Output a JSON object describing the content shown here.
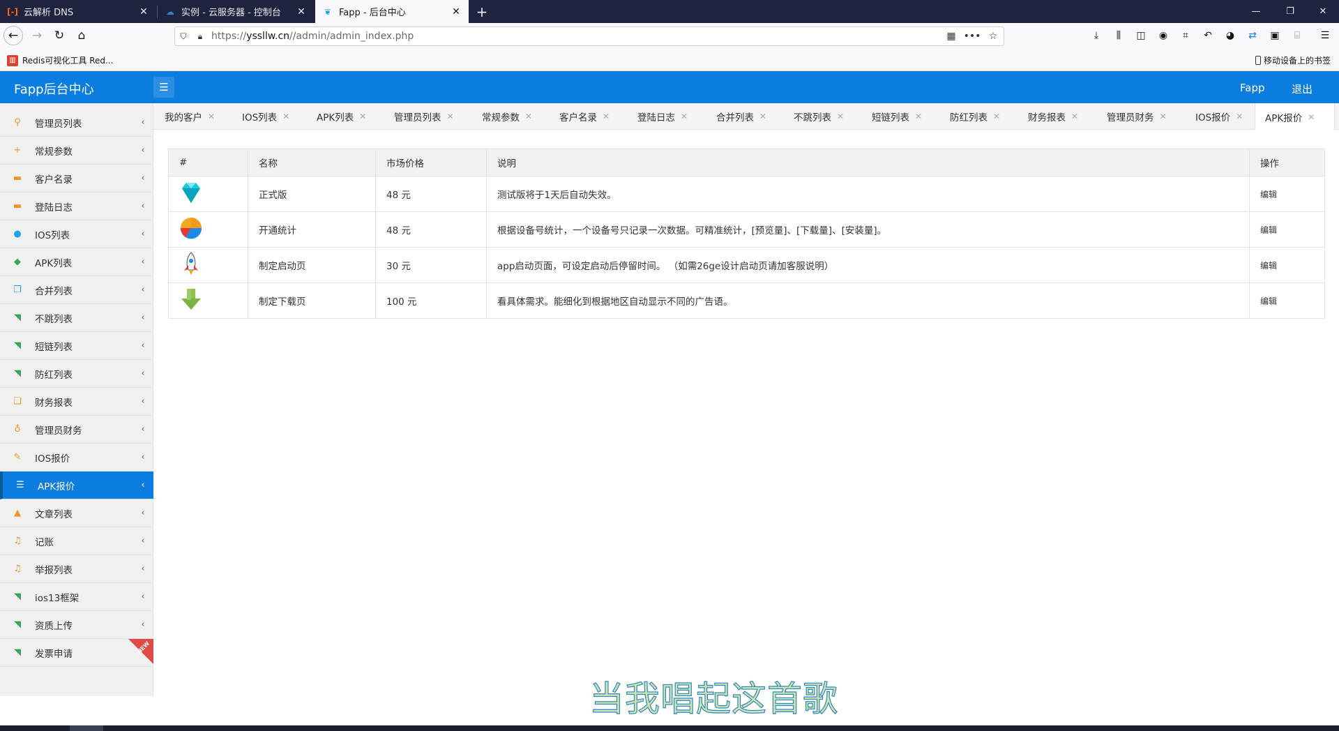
{
  "browser": {
    "tabs": [
      {
        "title": "云解析 DNS"
      },
      {
        "title": "实例 - 云服务器 - 控制台"
      },
      {
        "title": "Fapp - 后台中心"
      }
    ],
    "url_prefix": "https://",
    "url_domain": "yssllw.cn",
    "url_path": "//admin/admin_index.php",
    "bookmark": "Redis可视化工具 Red...",
    "bookmark_right": "移动设备上的书签"
  },
  "header": {
    "brand": "Fapp后台中心",
    "links": [
      "Fapp",
      "退出"
    ]
  },
  "sidebar": {
    "items": [
      {
        "label": "管理员列表",
        "icon": "key-icon",
        "glyph": "⚲",
        "color": "#f0932b"
      },
      {
        "label": "常规参数",
        "icon": "plus-icon",
        "glyph": "+",
        "color": "#f0932b"
      },
      {
        "label": "客户名录",
        "icon": "briefcase-icon",
        "glyph": "▬",
        "color": "#f0932b"
      },
      {
        "label": "登陆日志",
        "icon": "briefcase-icon",
        "glyph": "▬",
        "color": "#f0932b"
      },
      {
        "label": "IOS列表",
        "icon": "apple-icon",
        "glyph": "●",
        "color": "#20a4e8"
      },
      {
        "label": "APK列表",
        "icon": "android-icon",
        "glyph": "◆",
        "color": "#3aa655"
      },
      {
        "label": "合并列表",
        "icon": "copy-icon",
        "glyph": "❐",
        "color": "#20a4e8"
      },
      {
        "label": "不跳列表",
        "icon": "rss-icon",
        "glyph": "◥",
        "color": "#3aa655"
      },
      {
        "label": "短链列表",
        "icon": "rss-icon",
        "glyph": "◥",
        "color": "#3aa655"
      },
      {
        "label": "防红列表",
        "icon": "rss-icon",
        "glyph": "◥",
        "color": "#3aa655"
      },
      {
        "label": "财务报表",
        "icon": "files-icon",
        "glyph": "❏",
        "color": "#f0932b"
      },
      {
        "label": "管理员财务",
        "icon": "stethoscope-icon",
        "glyph": "♁",
        "color": "#f0932b"
      },
      {
        "label": "IOS报价",
        "icon": "pencil-icon",
        "glyph": "✎",
        "color": "#f0932b"
      },
      {
        "label": "APK报价",
        "icon": "list-icon",
        "glyph": "☰",
        "color": "#ffffff"
      },
      {
        "label": "文章列表",
        "icon": "flask-icon",
        "glyph": "▲",
        "color": "#f0932b"
      },
      {
        "label": "记账",
        "icon": "music-icon",
        "glyph": "♫",
        "color": "#f0932b"
      },
      {
        "label": "举报列表",
        "icon": "music-icon",
        "glyph": "♫",
        "color": "#f0932b"
      },
      {
        "label": "ios13框架",
        "icon": "rss-icon",
        "glyph": "◥",
        "color": "#3aa655"
      },
      {
        "label": "资质上传",
        "icon": "rss-icon",
        "glyph": "◥",
        "color": "#3aa655"
      },
      {
        "label": "发票申请",
        "icon": "rss-icon",
        "glyph": "◥",
        "color": "#3aa655"
      }
    ],
    "active_index": 13,
    "new_badge": "NEW"
  },
  "page_tabs": [
    "我的客户",
    "IOS列表",
    "APK列表",
    "管理员列表",
    "常规参数",
    "客户名录",
    "登陆日志",
    "合并列表",
    "不跳列表",
    "短链列表",
    "防红列表",
    "财务报表",
    "管理员财务",
    "IOS报价",
    "APK报价"
  ],
  "page_tabs_active": 14,
  "table": {
    "headers": [
      "#",
      "名称",
      "市场价格",
      "说明",
      "操作"
    ],
    "rows": [
      {
        "icon": "diamond-icon",
        "name": "正式版",
        "price": "48 元",
        "desc": "测试版将于1天后自动失效。",
        "op": "编辑"
      },
      {
        "icon": "pie-chart-icon",
        "name": "开通统计",
        "price": "48 元",
        "desc": "根据设备号统计，一个设备号只记录一次数据。可精准统计，[预览量]、[下载量]、[安装量]。",
        "op": "编辑"
      },
      {
        "icon": "rocket-icon",
        "name": "制定启动页",
        "price": "30 元",
        "desc": "app启动页面，可设定启动后停留时间。 （如需26ge设计启动页请加客服说明）",
        "op": "编辑"
      },
      {
        "icon": "download-arrow-icon",
        "name": "制定下载页",
        "price": "100 元",
        "desc": "看具体需求。能细化到根据地区自动显示不同的广告语。",
        "op": "编辑"
      }
    ]
  },
  "lyrics": "当我唱起这首歌",
  "colors": {
    "accent": "#0b7de0",
    "sidebar_bg": "#f0f0f0",
    "tabbar_bg": "#202340"
  }
}
